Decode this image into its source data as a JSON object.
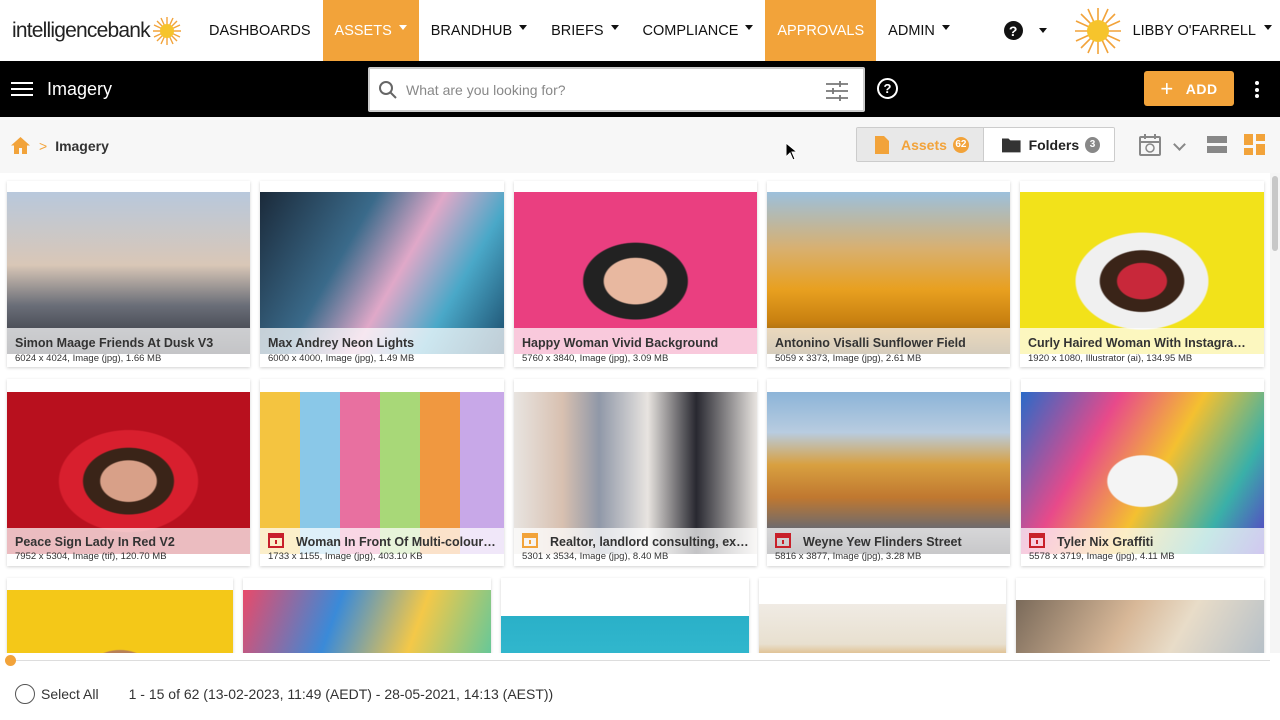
{
  "brand": {
    "name_a": "intelligence",
    "name_b": "bank",
    "accent": "#f2a33a"
  },
  "topnav": {
    "items": [
      {
        "label": "DASHBOARDS",
        "active": false,
        "dropdown": false
      },
      {
        "label": "ASSETS",
        "active": true,
        "dropdown": true
      },
      {
        "label": "BRANDHUB",
        "active": false,
        "dropdown": true
      },
      {
        "label": "BRIEFS",
        "active": false,
        "dropdown": true
      },
      {
        "label": "COMPLIANCE",
        "active": false,
        "dropdown": true
      },
      {
        "label": "APPROVALS",
        "active": true,
        "dropdown": false
      },
      {
        "label": "ADMIN",
        "active": false,
        "dropdown": true
      }
    ],
    "help_label": "?",
    "user_name": "LIBBY O'FARRELL"
  },
  "toolbar": {
    "section_title": "Imagery",
    "search_placeholder": "What are you looking for?",
    "help_label": "?",
    "add_label": "ADD",
    "add_plus": "+"
  },
  "breadcrumb": {
    "separator": ">",
    "current": "Imagery"
  },
  "view_toggle": {
    "assets_label": "Assets",
    "assets_count": "62",
    "folders_label": "Folders",
    "folders_count": "3"
  },
  "cards": [
    {
      "title": "Simon Maage Friends At Dusk V3",
      "meta": "6024 x 4024, Image (jpg), 1.66 MB",
      "flag": ""
    },
    {
      "title": "Max Andrey Neon Lights",
      "meta": "6000 x 4000, Image (jpg), 1.49 MB",
      "flag": ""
    },
    {
      "title": "Happy Woman Vivid Background",
      "meta": "5760 x 3840, Image (jpg), 3.09 MB",
      "flag": ""
    },
    {
      "title": "Antonino Visalli Sunflower Field",
      "meta": "5059 x 3373, Image (jpg), 2.61 MB",
      "flag": ""
    },
    {
      "title": "Curly Haired Woman With Instagram Frame",
      "meta": "1920 x 1080, Illustrator (ai), 134.95 MB",
      "flag": ""
    },
    {
      "title": "Peace Sign Lady In Red V2",
      "meta": "7952 x 5304, Image (tif), 120.70 MB",
      "flag": ""
    },
    {
      "title": "Woman In Front Of Multi-coloured Wall",
      "meta": "1733 x 1155, Image (jpg), 403.10 KB",
      "flag": "red"
    },
    {
      "title": "Realtor, landlord consulting, explaining",
      "meta": "5301 x 3534, Image (jpg), 8.40 MB",
      "flag": "orange"
    },
    {
      "title": "Weyne Yew Flinders Street",
      "meta": "5816 x 3877, Image (jpg), 3.28 MB",
      "flag": "red"
    },
    {
      "title": "Tyler Nix Graffiti",
      "meta": "5578 x 3719, Image (jpg), 4.11 MB",
      "flag": "red"
    }
  ],
  "footer": {
    "select_all": "Select All",
    "range": "1 - 15 of 62 (13-02-2023, 11:49 (AEDT) - 28-05-2021, 14:13 (AEST))"
  }
}
